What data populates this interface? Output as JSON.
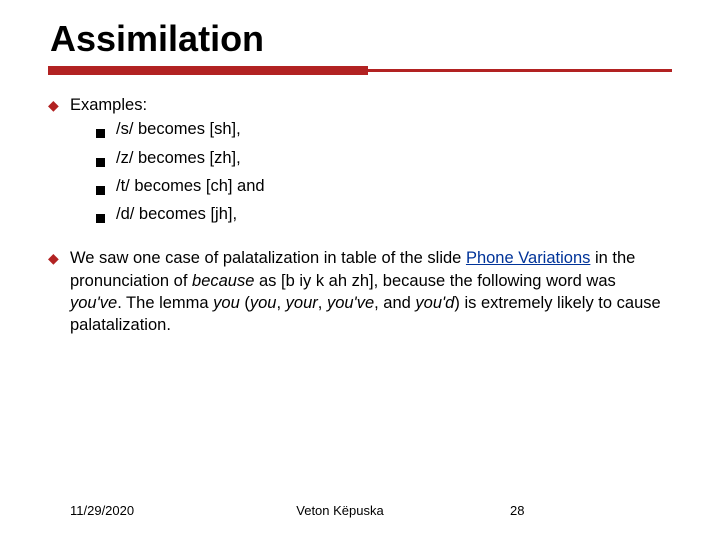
{
  "title": "Assimilation",
  "examples_label": "Examples:",
  "examples": [
    "/s/ becomes [sh],",
    "/z/ becomes [zh],",
    "/t/ becomes [ch] and",
    "/d/ becomes [jh],"
  ],
  "para": {
    "p1": "We saw one case of palatalization in table of the slide ",
    "link": "Phone Variations",
    "p2": " in the pronunciation of ",
    "i1": "because",
    "p3": " as [b iy k ah zh], because the following word was ",
    "i2": "you've",
    "p4": ". The lemma ",
    "i3": "you",
    "p5": " (",
    "i4": "you",
    "p6": ", ",
    "i5": "your",
    "p7": ", ",
    "i6": "you've",
    "p8": ", and ",
    "i7": "you'd",
    "p9": ") is extremely likely to cause palatalization."
  },
  "footer": {
    "date": "11/29/2020",
    "author": "Veton Këpuska",
    "page": "28"
  }
}
